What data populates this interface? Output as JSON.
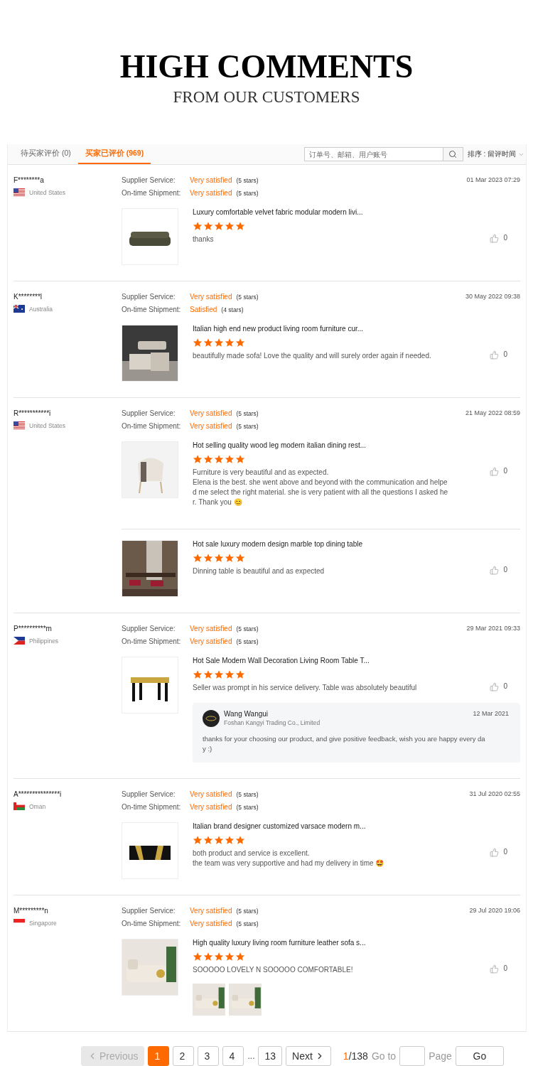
{
  "header": {
    "title": "HIGH COMMENTS",
    "subtitle": "FROM OUR CUSTOMERS"
  },
  "tabs": [
    {
      "label": "待买家评价 (0)",
      "selected": false
    },
    {
      "label": "买家已评价 (969)",
      "selected": true
    }
  ],
  "search": {
    "placeholder": "订单号、邮箱、用户账号"
  },
  "sort": {
    "label": "排序 : 留评时间"
  },
  "reviews": [
    {
      "buyer": "F********a",
      "country": "United States",
      "flag": {
        "kind": "us"
      },
      "date": "01 Mar 2023 07:29",
      "ratings": [
        {
          "label": "Supplier Service:",
          "value": "Very satisfied",
          "stars_text": "(5 stars)"
        },
        {
          "label": "On-time Shipment:",
          "value": "Very satisfied",
          "stars_text": "(5 stars)"
        }
      ],
      "products": [
        {
          "title": "Luxury comfortable velvet fabric modular modern livi...",
          "stars": 5,
          "comment_lines": [
            "thanks"
          ],
          "likes": "0"
        }
      ]
    },
    {
      "buyer": "K********l",
      "country": "Australia",
      "flag": {
        "kind": "au"
      },
      "date": "30 May 2022 09:38",
      "ratings": [
        {
          "label": "Supplier Service:",
          "value": "Very satisfied",
          "stars_text": "(5 stars)"
        },
        {
          "label": "On-time Shipment:",
          "value": "Satisfied",
          "stars_text": "(4 stars)"
        }
      ],
      "products": [
        {
          "title": "Italian high end new product living room furniture cur...",
          "stars": 5,
          "comment_lines": [
            "beautifully made sofa! Love the quality and will surely order again if needed."
          ],
          "likes": "0"
        }
      ]
    },
    {
      "buyer": "R***********i",
      "country": "United States",
      "flag": {
        "kind": "us"
      },
      "date": "21 May 2022 08:59",
      "ratings": [
        {
          "label": "Supplier Service:",
          "value": "Very satisfied",
          "stars_text": "(5 stars)"
        },
        {
          "label": "On-time Shipment:",
          "value": "Very satisfied",
          "stars_text": "(5 stars)"
        }
      ],
      "products": [
        {
          "title": "Hot selling quality wood leg modern italian dining rest...",
          "stars": 5,
          "comment_lines": [
            "Furniture is very beautiful and as expected.",
            "Elena is the best. she went above and beyond with the communication and helpe",
            "d me select the right material. she is very patient with all the questions I asked he",
            "r. Thank you 😊"
          ],
          "likes": "0"
        },
        {
          "title": "Hot sale luxury modern design marble top dining table",
          "stars": 5,
          "comment_lines": [
            "Dinning table is beautiful and as expected"
          ],
          "likes": "0"
        }
      ]
    },
    {
      "buyer": "P**********m",
      "country": "Philippines",
      "flag": {
        "kind": "ph"
      },
      "date": "29 Mar 2021 09:33",
      "ratings": [
        {
          "label": "Supplier Service:",
          "value": "Very satisfied",
          "stars_text": "(5 stars)"
        },
        {
          "label": "On-time Shipment:",
          "value": "Very satisfied",
          "stars_text": "(5 stars)"
        }
      ],
      "products": [
        {
          "title": "Hot Sale Modern Wall Decoration Living Room Table T...",
          "stars": 5,
          "comment_lines": [
            "Seller was prompt in his service delivery. Table was absolutely beautiful"
          ],
          "likes": "0",
          "reply": {
            "name": "Wang Wangui",
            "company": "Foshan Kangyi Trading Co., Limited",
            "date": "12 Mar 2021",
            "lines": [
              "thanks for your choosing our product, and give positive feedback, wish you are happy every da",
              "y :)"
            ]
          }
        }
      ]
    },
    {
      "buyer": "A***************i",
      "country": "Oman",
      "flag": {
        "kind": "om"
      },
      "date": "31 Jul 2020 02:55",
      "ratings": [
        {
          "label": "Supplier Service:",
          "value": "Very satisfied",
          "stars_text": "(5 stars)"
        },
        {
          "label": "On-time Shipment:",
          "value": "Very satisfied",
          "stars_text": "(5 stars)"
        }
      ],
      "products": [
        {
          "title": "Italian brand designer customized varsace modern m...",
          "stars": 5,
          "comment_lines": [
            "both product and service is excellent.",
            "the team was very supportive and had my delivery in time 🤩"
          ],
          "likes": "0"
        }
      ]
    },
    {
      "buyer": "M*********n",
      "country": "Singapore",
      "flag": {
        "kind": "sg"
      },
      "date": "29 Jul 2020 19:06",
      "ratings": [
        {
          "label": "Supplier Service:",
          "value": "Very satisfied",
          "stars_text": "(5 stars)"
        },
        {
          "label": "On-time Shipment:",
          "value": "Very satisfied",
          "stars_text": "(5 stars)"
        }
      ],
      "products": [
        {
          "title": "High quality luxury living room furniture leather sofa s...",
          "stars": 5,
          "comment_lines": [
            "SOOOOO LOVELY N SOOOOO COMFORTABLE!"
          ],
          "likes": "0",
          "photos": [
            {
              "kind": "picture"
            },
            {
              "kind": "picture"
            }
          ]
        }
      ]
    }
  ],
  "pagination": {
    "previous": {
      "label": "Previous",
      "disabled": true
    },
    "items": [
      {
        "kind": "page",
        "label": "1",
        "selected": true
      },
      {
        "kind": "page",
        "label": "2",
        "selected": false
      },
      {
        "kind": "page",
        "label": "3",
        "selected": false
      },
      {
        "kind": "page",
        "label": "4",
        "selected": false
      },
      {
        "kind": "ellipsis",
        "label": "..."
      },
      {
        "kind": "page",
        "label": "13",
        "selected": false
      }
    ],
    "next": {
      "label": "Next",
      "disabled": false
    },
    "current": "1",
    "total": "/138",
    "goto_label": "Go to",
    "page_label": "Page",
    "go_button": "Go"
  }
}
